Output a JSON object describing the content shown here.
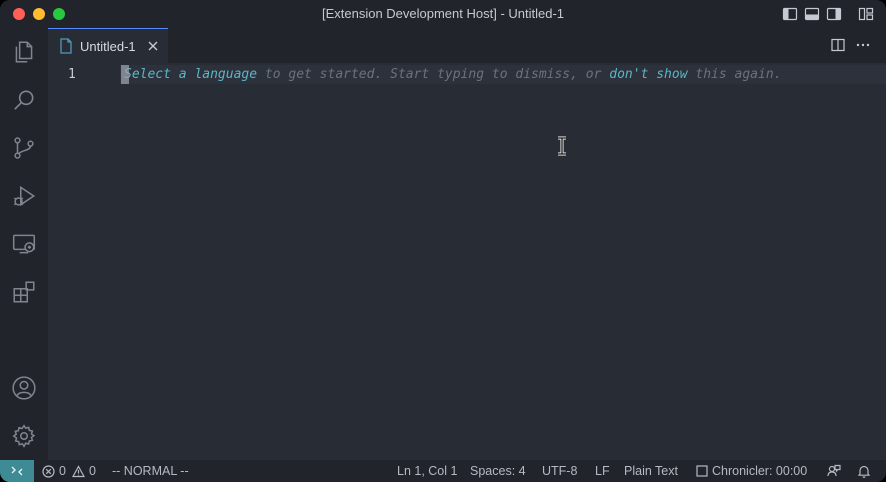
{
  "window": {
    "title": "[Extension Development Host] - Untitled-1"
  },
  "titlebar_icons": [
    "toggle-primary-sidebar-icon",
    "toggle-panel-icon",
    "toggle-secondary-sidebar-icon",
    "customize-layout-icon"
  ],
  "activity_bar": [
    "explorer-icon",
    "search-icon",
    "source-control-icon",
    "run-and-debug-icon",
    "remote-explorer-icon",
    "extensions-icon",
    "accounts-icon",
    "manage-gear-icon"
  ],
  "tab": {
    "label": "Untitled-1"
  },
  "editor_actions": [
    "split-editor-icon",
    "more-actions-icon"
  ],
  "editor": {
    "line_number": "1",
    "hint": {
      "link1": "Select a language",
      "text1": " to get started. Start typing to dismiss, or ",
      "link2": "don't show",
      "text2": " this again."
    }
  },
  "status_bar": {
    "errors": "0",
    "warnings": "0",
    "mode": "-- NORMAL --",
    "position": "Ln 1, Col 1",
    "spaces": "Spaces: 4",
    "encoding": "UTF-8",
    "eol": "LF",
    "language": "Plain Text",
    "chronicler": "Chronicler: 00:00"
  },
  "colors": {
    "remote_indicator": "#3e8a95",
    "tab_accent": "#528bff",
    "hint_link": "#5cb6c4"
  }
}
